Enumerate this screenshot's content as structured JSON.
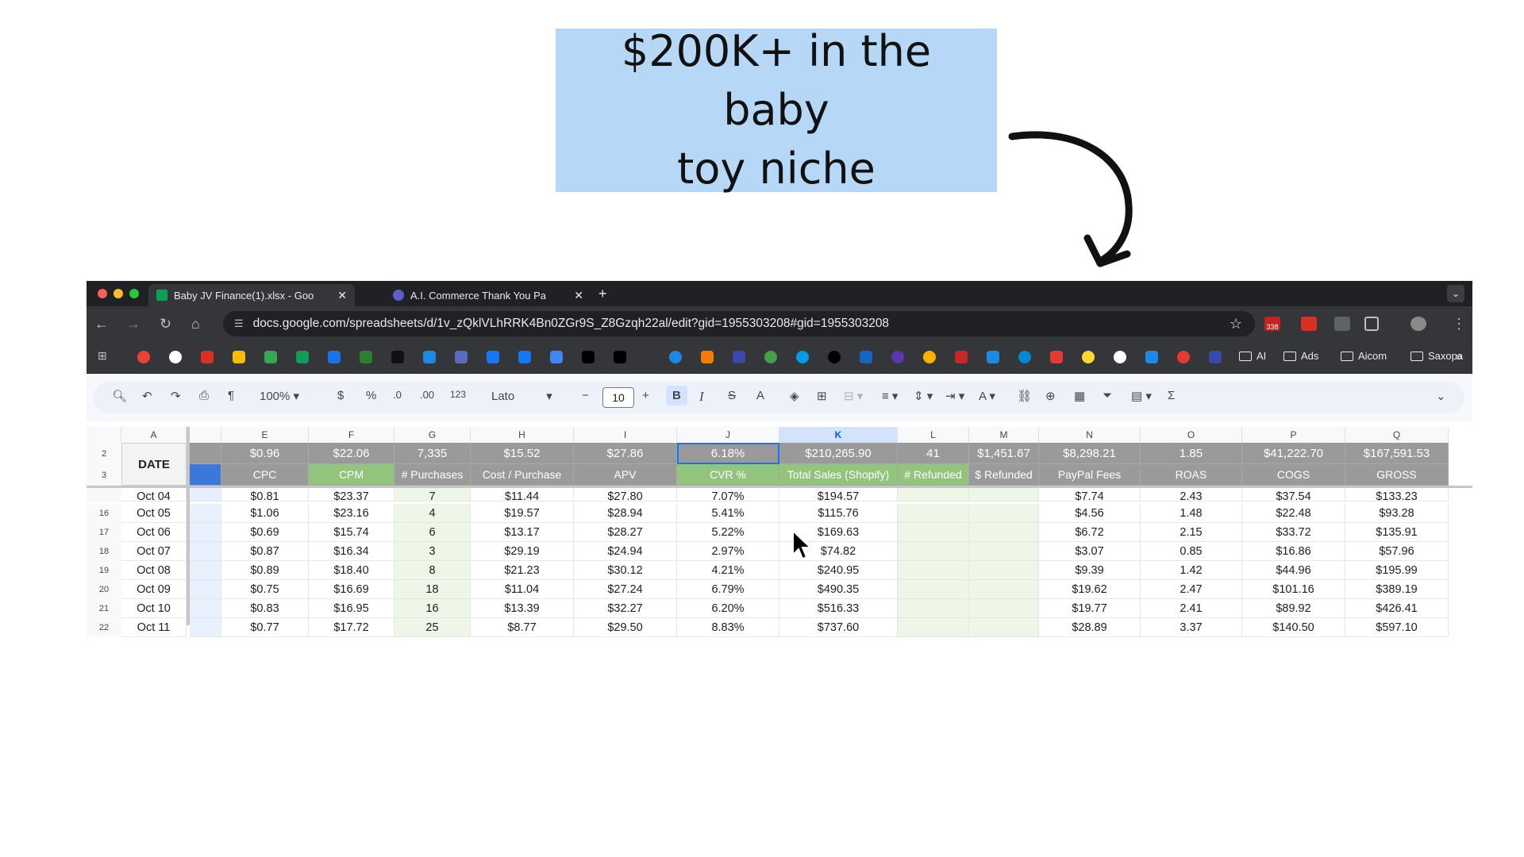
{
  "headline": {
    "line1": "$200K+ in the baby",
    "line2": "toy niche"
  },
  "browser": {
    "tabs": [
      {
        "title": "Baby JV Finance(1).xlsx - Goo",
        "icon": "google-sheets-icon",
        "active": true
      },
      {
        "title": "A.I. Commerce Thank You Pa",
        "icon": "ai-commerce-icon",
        "active": false
      }
    ],
    "url": "docs.google.com/spreadsheets/d/1v_zQklVLhRRK4Bn0ZGr9S_Z8Gzqh22al/edit?gid=1955303208#gid=1955303208",
    "calendar_badge": "338",
    "bookmark_folders": [
      "AI",
      "Ads",
      "Aicom",
      "Saxopa"
    ]
  },
  "toolbar": {
    "zoom": "100%",
    "currency": "$",
    "percent": "%",
    "decrease_decimal": ".0",
    "increase_decimal": ".00",
    "number_format": "123",
    "font": "Lato",
    "font_size": "10",
    "bold": "B",
    "italic": "I",
    "strike": "S",
    "text_color": "A",
    "sum": "Σ"
  },
  "sheet": {
    "columns": [
      "A",
      "E",
      "F",
      "G",
      "H",
      "I",
      "J",
      "K",
      "L",
      "M",
      "N",
      "O",
      "P",
      "Q"
    ],
    "selected_column": "K",
    "date_header": "DATE",
    "summary_row_num": "2",
    "header_row_num": "3",
    "summary": [
      "",
      "$0.96",
      "$22.06",
      "7,335",
      "$15.52",
      "$27.86",
      "6.18%",
      "$210,265.90",
      "41",
      "$1,451.67",
      "$8,298.21",
      "1.85",
      "$41,222.70",
      "$167,591.53"
    ],
    "headers": [
      "",
      "CPC",
      "CPM",
      "# Purchases",
      "Cost / Purchase",
      "APV",
      "CVR %",
      "Total Sales (Shopify)",
      "# Refunded",
      "$ Refunded",
      "PayPal Fees",
      "ROAS",
      "COGS",
      "GROSS"
    ],
    "rows": [
      {
        "num": "",
        "cells": [
          "Oct 04",
          "",
          "$0.81",
          "$23.37",
          "7",
          "$11.44",
          "$27.80",
          "7.07%",
          "$194.57",
          "",
          "",
          "$7.74",
          "2.43",
          "$37.54",
          "$133.23"
        ]
      },
      {
        "num": "16",
        "cells": [
          "Oct 05",
          "",
          "$1.06",
          "$23.16",
          "4",
          "$19.57",
          "$28.94",
          "5.41%",
          "$115.76",
          "",
          "",
          "$4.56",
          "1.48",
          "$22.48",
          "$93.28"
        ]
      },
      {
        "num": "17",
        "cells": [
          "Oct 06",
          "",
          "$0.69",
          "$15.74",
          "6",
          "$13.17",
          "$28.27",
          "5.22%",
          "$169.63",
          "",
          "",
          "$6.72",
          "2.15",
          "$33.72",
          "$135.91"
        ]
      },
      {
        "num": "18",
        "cells": [
          "Oct 07",
          "",
          "$0.87",
          "$16.34",
          "3",
          "$29.19",
          "$24.94",
          "2.97%",
          "$74.82",
          "",
          "",
          "$3.07",
          "0.85",
          "$16.86",
          "$57.96"
        ]
      },
      {
        "num": "19",
        "cells": [
          "Oct 08",
          "",
          "$0.89",
          "$18.40",
          "8",
          "$21.23",
          "$30.12",
          "4.21%",
          "$240.95",
          "",
          "",
          "$9.39",
          "1.42",
          "$44.96",
          "$195.99"
        ]
      },
      {
        "num": "20",
        "cells": [
          "Oct 09",
          "",
          "$0.75",
          "$16.69",
          "18",
          "$11.04",
          "$27.24",
          "6.79%",
          "$490.35",
          "",
          "",
          "$19.62",
          "2.47",
          "$101.16",
          "$389.19"
        ]
      },
      {
        "num": "21",
        "cells": [
          "Oct 10",
          "",
          "$0.83",
          "$16.95",
          "16",
          "$13.39",
          "$32.27",
          "6.20%",
          "$516.33",
          "",
          "",
          "$19.77",
          "2.41",
          "$89.92",
          "$426.41"
        ]
      },
      {
        "num": "22",
        "cells": [
          "Oct 11",
          "",
          "$0.77",
          "$17.72",
          "25",
          "$8.77",
          "$29.50",
          "8.83%",
          "$737.60",
          "",
          "",
          "$28.89",
          "3.37",
          "$140.50",
          "$597.10"
        ]
      }
    ]
  },
  "colors": {
    "callout": "#b6d7f6",
    "header_gray": "#9a9a9a",
    "header_green": "#93c47d",
    "header_blue": "#3c78d8",
    "selection": "#1a73e8"
  }
}
